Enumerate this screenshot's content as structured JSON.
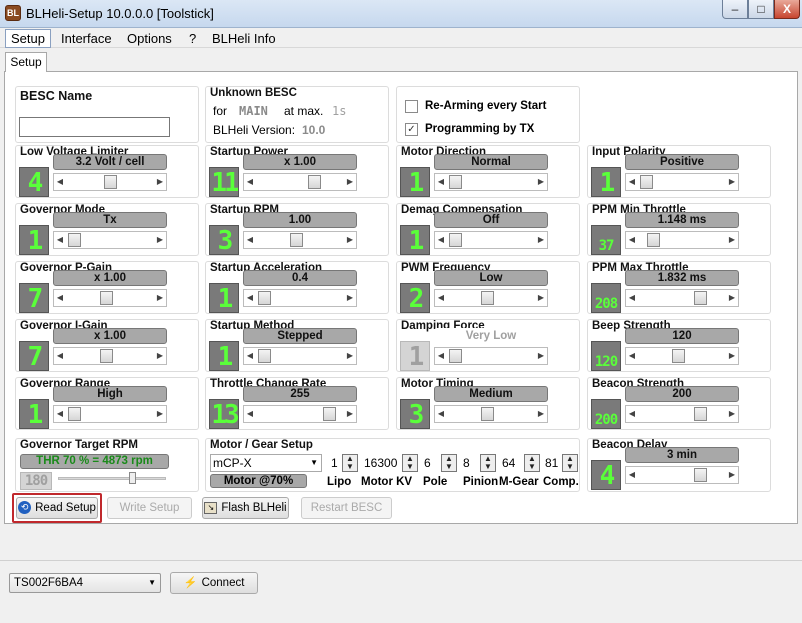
{
  "window": {
    "title": "BLHeli-Setup 10.0.0.0 [Toolstick]",
    "icon_label": "BL",
    "minimize": "–",
    "maximize": "□",
    "close": "X"
  },
  "menu": [
    "Setup",
    "Interface",
    "Options",
    "?",
    "BLHeli Info"
  ],
  "tab": "Setup",
  "besc_name": {
    "title": "BESC Name",
    "value": ""
  },
  "unknown": {
    "title": "Unknown BESC",
    "for": "for",
    "main": "MAIN",
    "atmax": "at max.",
    "seconds": "1s",
    "version_label": "BLHeli Version:",
    "version": "10.0"
  },
  "checks": {
    "rearm": "Re-Arming every Start",
    "rearm_checked": false,
    "prog": "Programming by TX",
    "prog_checked": true
  },
  "params": {
    "lvl": {
      "title": "Low Voltage Limiter",
      "num": "4",
      "value": "3.2 Volt / cell",
      "pos": 0.5
    },
    "sp": {
      "title": "Startup Power",
      "num": "11",
      "value": "x 1.00",
      "pos": 0.7
    },
    "md": {
      "title": "Motor Direction",
      "num": "1",
      "value": "Normal",
      "pos": 0.0
    },
    "ip": {
      "title": "Input Polarity",
      "num": "1",
      "value": "Positive",
      "pos": 0.0
    },
    "gm": {
      "title": "Governor Mode",
      "num": "1",
      "value": "Tx",
      "pos": 0.0
    },
    "srpm": {
      "title": "Startup RPM",
      "num": "3",
      "value": "1.00",
      "pos": 0.45
    },
    "dc": {
      "title": "Demag Compensation",
      "num": "1",
      "value": "Off",
      "pos": 0.0
    },
    "pmin": {
      "title": "PPM Min Throttle",
      "num": "37",
      "value": "1.148 ms",
      "pos": 0.1
    },
    "gp": {
      "title": "Governor P-Gain",
      "num": "7",
      "value": "x 1.00",
      "pos": 0.45
    },
    "sa": {
      "title": "Startup Acceleration",
      "num": "1",
      "value": "0.4",
      "pos": 0.0
    },
    "pwm": {
      "title": "PWM Frequency",
      "num": "2",
      "value": "Low",
      "pos": 0.45
    },
    "pmax": {
      "title": "PPM Max Throttle",
      "num": "208",
      "value": "1.832 ms",
      "pos": 0.75
    },
    "gi": {
      "title": "Governor I-Gain",
      "num": "7",
      "value": "x 1.00",
      "pos": 0.45
    },
    "sm": {
      "title": "Startup Method",
      "num": "1",
      "value": "Stepped",
      "pos": 0.0
    },
    "df": {
      "title": "Damping Force",
      "num": "1",
      "value": "Very Low",
      "pos": 0.0
    },
    "bs": {
      "title": "Beep Strength",
      "num": "120",
      "value": "120",
      "pos": 0.45
    },
    "gr": {
      "title": "Governor Range",
      "num": "1",
      "value": "High",
      "pos": 0.0
    },
    "tcr": {
      "title": "Throttle Change  Rate",
      "num": "13",
      "value": "255",
      "pos": 0.9
    },
    "mt": {
      "title": "Motor Timing",
      "num": "3",
      "value": "Medium",
      "pos": 0.45
    },
    "bcs": {
      "title": "Beacon Strength",
      "num": "200",
      "value": "200",
      "pos": 0.75
    },
    "bd": {
      "title": "Beacon Delay",
      "num": "4",
      "value": "3 min",
      "pos": 0.75
    }
  },
  "gov_rpm": {
    "title": "Governor Target RPM",
    "value": "THR 70 % = 4873 rpm",
    "num": "180"
  },
  "motor": {
    "title": "Motor / Gear Setup",
    "model": "mCP-X",
    "badge": "Motor @70%",
    "lipo": "1",
    "kv": "16300",
    "pole": "6",
    "pinion": "8",
    "mgear": "64",
    "comp": "81",
    "labels": [
      "Lipo",
      "Motor KV",
      "Pole",
      "Pinion",
      "M-Gear",
      "Comp."
    ]
  },
  "buttons": {
    "read": "Read Setup",
    "write": "Write Setup",
    "flash": "Flash BLHeli",
    "restart": "Restart BESC"
  },
  "port": {
    "value": "TS002F6BA4",
    "connect": "Connect"
  },
  "colors": {
    "digit": "#5aff3a",
    "highlight": "#c0282c"
  }
}
